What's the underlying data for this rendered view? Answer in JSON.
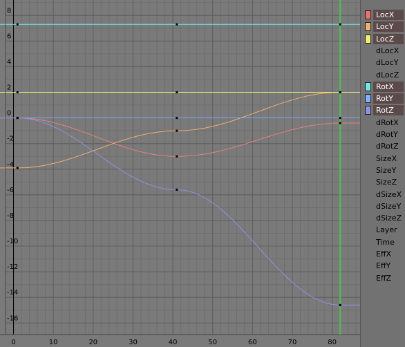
{
  "ipo_editor": {
    "x_axis": {
      "range": [
        -2,
        87
      ],
      "major_step": 10,
      "minor_step": 2,
      "tick_labels": [
        "0",
        "10",
        "20",
        "30",
        "40",
        "50",
        "60",
        "70",
        "80"
      ]
    },
    "y_axis": {
      "range": [
        -16.9,
        9.2
      ],
      "major_step": 2,
      "minor_step": 1,
      "tick_labels": [
        "8",
        "6",
        "4",
        "2",
        "0",
        "-2",
        "-4",
        "-6",
        "-8",
        "-10",
        "-12",
        "-14",
        "-16"
      ]
    },
    "current_frame": 82,
    "colors": {
      "background": "#7a7a7a",
      "grid_major": "#5e5e5e",
      "grid_minor": "#6e6e6e",
      "frame_line": "#50c050",
      "zero_axis_x": "#000000",
      "ruler": "#7a7a7a",
      "handle": "#000000"
    }
  },
  "chart_data": {
    "type": "line",
    "xlabel": "",
    "ylabel": "",
    "xlim": [
      -2,
      87
    ],
    "ylim": [
      -16.9,
      9.2
    ],
    "series": [
      {
        "name": "LocX",
        "color": "#e88080",
        "points": [
          [
            1,
            0
          ],
          [
            41,
            -3
          ],
          [
            82,
            -0.4
          ],
          [
            87,
            -0.4
          ]
        ]
      },
      {
        "name": "LocY",
        "color": "#f0b070",
        "points": [
          [
            -2,
            -3.9
          ],
          [
            1,
            -3.9
          ],
          [
            41,
            -1
          ],
          [
            82,
            2
          ],
          [
            87,
            2
          ]
        ]
      },
      {
        "name": "LocZ",
        "color": "#f0f070",
        "points": [
          [
            -2,
            2
          ],
          [
            87,
            2
          ]
        ]
      },
      {
        "name": "RotX",
        "color": "#70e8e8",
        "points": [
          [
            -2,
            7.3
          ],
          [
            87,
            7.3
          ]
        ]
      },
      {
        "name": "RotY",
        "color": "#80b0ff",
        "points": [
          [
            -2,
            0
          ],
          [
            87,
            0
          ]
        ]
      },
      {
        "name": "RotZ",
        "color": "#9090e0",
        "points": [
          [
            1,
            0
          ],
          [
            41,
            -5.6
          ],
          [
            82,
            -14.6
          ],
          [
            87,
            -14.6
          ]
        ]
      }
    ],
    "keyframes": [
      {
        "series": "LocX",
        "points": [
          [
            1,
            0
          ],
          [
            41,
            -3
          ],
          [
            82,
            -0.4
          ]
        ]
      },
      {
        "series": "LocY",
        "points": [
          [
            1,
            -3.9
          ],
          [
            41,
            -1
          ],
          [
            82,
            2
          ]
        ]
      },
      {
        "series": "LocZ",
        "points": [
          [
            1,
            2
          ],
          [
            41,
            2
          ],
          [
            82,
            2
          ]
        ]
      },
      {
        "series": "RotX",
        "points": [
          [
            1,
            7.3
          ],
          [
            41,
            7.3
          ],
          [
            82,
            7.3
          ]
        ]
      },
      {
        "series": "RotY",
        "points": [
          [
            1,
            0
          ],
          [
            41,
            0
          ],
          [
            82,
            0
          ]
        ]
      },
      {
        "series": "RotZ",
        "points": [
          [
            1,
            0
          ],
          [
            41,
            -5.6
          ],
          [
            82,
            -14.6
          ]
        ]
      }
    ]
  },
  "channels": [
    {
      "label": "LocX",
      "active": true,
      "color": "#e87070"
    },
    {
      "label": "LocY",
      "active": true,
      "color": "#f0b070"
    },
    {
      "label": "LocZ",
      "active": true,
      "color": "#f0f070"
    },
    {
      "label": "dLocX",
      "active": false
    },
    {
      "label": "dLocY",
      "active": false
    },
    {
      "label": "dLocZ",
      "active": false
    },
    {
      "label": "RotX",
      "active": true,
      "color": "#70e8e8"
    },
    {
      "label": "RotY",
      "active": true,
      "color": "#80b0ff"
    },
    {
      "label": "RotZ",
      "active": true,
      "color": "#9090e0"
    },
    {
      "label": "dRotX",
      "active": false
    },
    {
      "label": "dRotY",
      "active": false
    },
    {
      "label": "dRotZ",
      "active": false
    },
    {
      "label": "SizeX",
      "active": false
    },
    {
      "label": "SizeY",
      "active": false
    },
    {
      "label": "SizeZ",
      "active": false
    },
    {
      "label": "dSizeX",
      "active": false
    },
    {
      "label": "dSizeY",
      "active": false
    },
    {
      "label": "dSizeZ",
      "active": false
    },
    {
      "label": "Layer",
      "active": false
    },
    {
      "label": "Time",
      "active": false
    },
    {
      "label": "EffX",
      "active": false
    },
    {
      "label": "EffY",
      "active": false
    },
    {
      "label": "EffZ",
      "active": false
    }
  ]
}
